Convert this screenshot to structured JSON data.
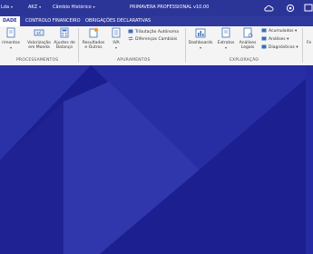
{
  "titlebar": {
    "company": "Lda",
    "year": "AKZ",
    "history": "Câmbio Histórico",
    "app_title": "PRIMAVERA PROFESSIONAL v10.00"
  },
  "tabs": [
    {
      "label": "DADE",
      "active": true
    },
    {
      "label": "CONTROLO FINANCEIRO",
      "active": false
    },
    {
      "label": "OBRIGAÇÕES DECLARATIVAS",
      "active": false
    }
  ],
  "ribbon": {
    "proc": {
      "b1": "rimentos",
      "b2_l1": "Valorização",
      "b2_l2": "em Moeda",
      "b3_l1": "Ajustes de",
      "b3_l2": "Balanço",
      "label": "PROCESSAMENTOS"
    },
    "apur": {
      "b1_l1": "Resultados",
      "b1_l2": "e Outros",
      "b2": "IVA",
      "s1": "Tributação Autónoma",
      "s2": "Diferenças Cambiais",
      "label": "APURAMENTOS"
    },
    "expl": {
      "b1": "Dashboards",
      "b2": "Extratos",
      "b3_l1": "Análises",
      "b3_l2": "Legais",
      "s1": "Acumulados",
      "s2": "Análises",
      "s3": "Diagnósticos",
      "label": "EXPLORAÇÃO"
    },
    "edge_label": "Fe"
  },
  "colors": {
    "background": "#1a1f8f",
    "titlebar": "#2b3597",
    "ribbon": "#f4f4f4"
  }
}
